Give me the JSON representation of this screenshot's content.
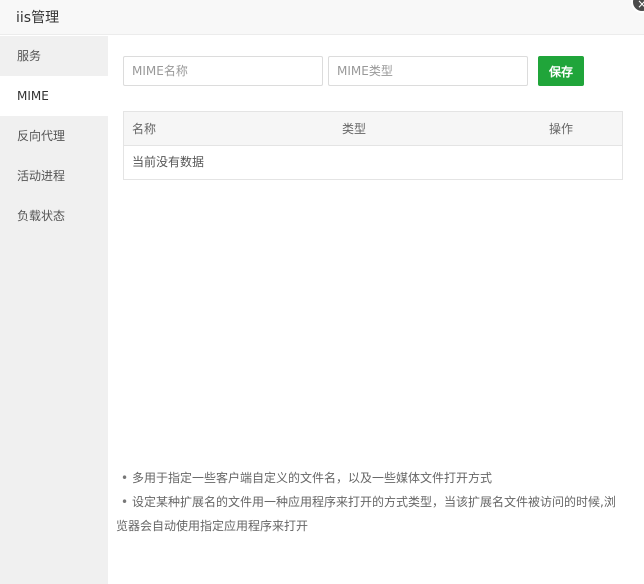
{
  "window": {
    "title": "iis管理",
    "close_glyph": "×"
  },
  "sidebar": {
    "items": [
      {
        "label": "服务"
      },
      {
        "label": "MIME"
      },
      {
        "label": "反向代理"
      },
      {
        "label": "活动进程"
      },
      {
        "label": "负载状态"
      }
    ],
    "active_index": 1
  },
  "form": {
    "name_placeholder": "MIME名称",
    "type_placeholder": "MIME类型",
    "save_label": "保存"
  },
  "table": {
    "columns": [
      "名称",
      "类型",
      "操作"
    ],
    "empty_text": "当前没有数据"
  },
  "notes": [
    "多用于指定一些客户端自定义的文件名，以及一些媒体文件打开方式",
    "设定某种扩展名的文件用一种应用程序来打开的方式类型，当该扩展名文件被访问的时候,浏",
    "览器会自动使用指定应用程序来打开"
  ],
  "colors": {
    "accent": "#20a53a",
    "sidebar_bg": "#f0f0f0",
    "header_bg": "#f6f6f6"
  }
}
